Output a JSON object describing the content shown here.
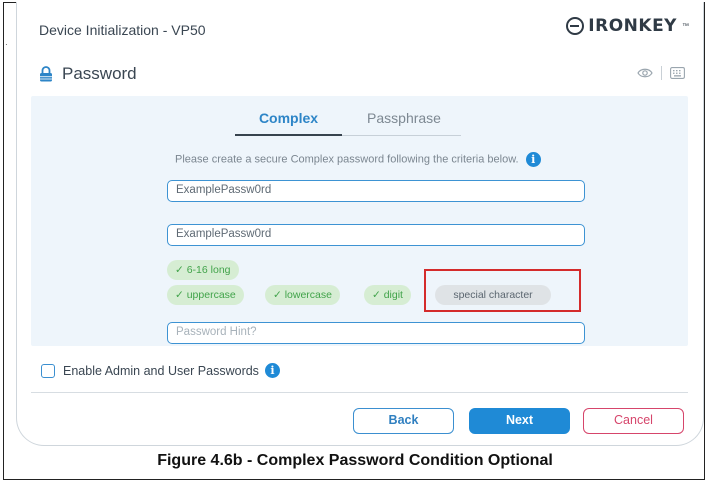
{
  "window": {
    "title": "Device Initialization - VP50",
    "brand": "IRONKEY",
    "brand_tm": "™"
  },
  "section": {
    "title": "Password",
    "icon": "lock-icon"
  },
  "header_icons": [
    "eye-icon",
    "keyboard-icon"
  ],
  "tabs": [
    {
      "label": "Complex",
      "active": true
    },
    {
      "label": "Passphrase",
      "active": false
    }
  ],
  "instruction": "Please create a secure Complex password following the criteria below.",
  "fields": {
    "password_value": "ExamplePassw0rd",
    "confirm_value": "ExamplePassw0rd",
    "hint_placeholder": "Password Hint?"
  },
  "criteria": [
    {
      "label": "✓ 6-16 long",
      "met": true
    },
    {
      "label": "✓ uppercase",
      "met": true
    },
    {
      "label": "✓ lowercase",
      "met": true
    },
    {
      "label": "✓ digit",
      "met": true
    },
    {
      "label": "special character",
      "met": false
    }
  ],
  "admin_option": {
    "label": "Enable Admin and User Passwords",
    "checked": false
  },
  "buttons": {
    "back": "Back",
    "next": "Next",
    "cancel": "Cancel"
  },
  "caption": "Figure 4.6b - Complex Password Condition Optional",
  "colors": {
    "accent": "#1f8ad6",
    "met": "#41a34a",
    "cancel": "#d6456b",
    "highlight": "#d42b2b"
  }
}
